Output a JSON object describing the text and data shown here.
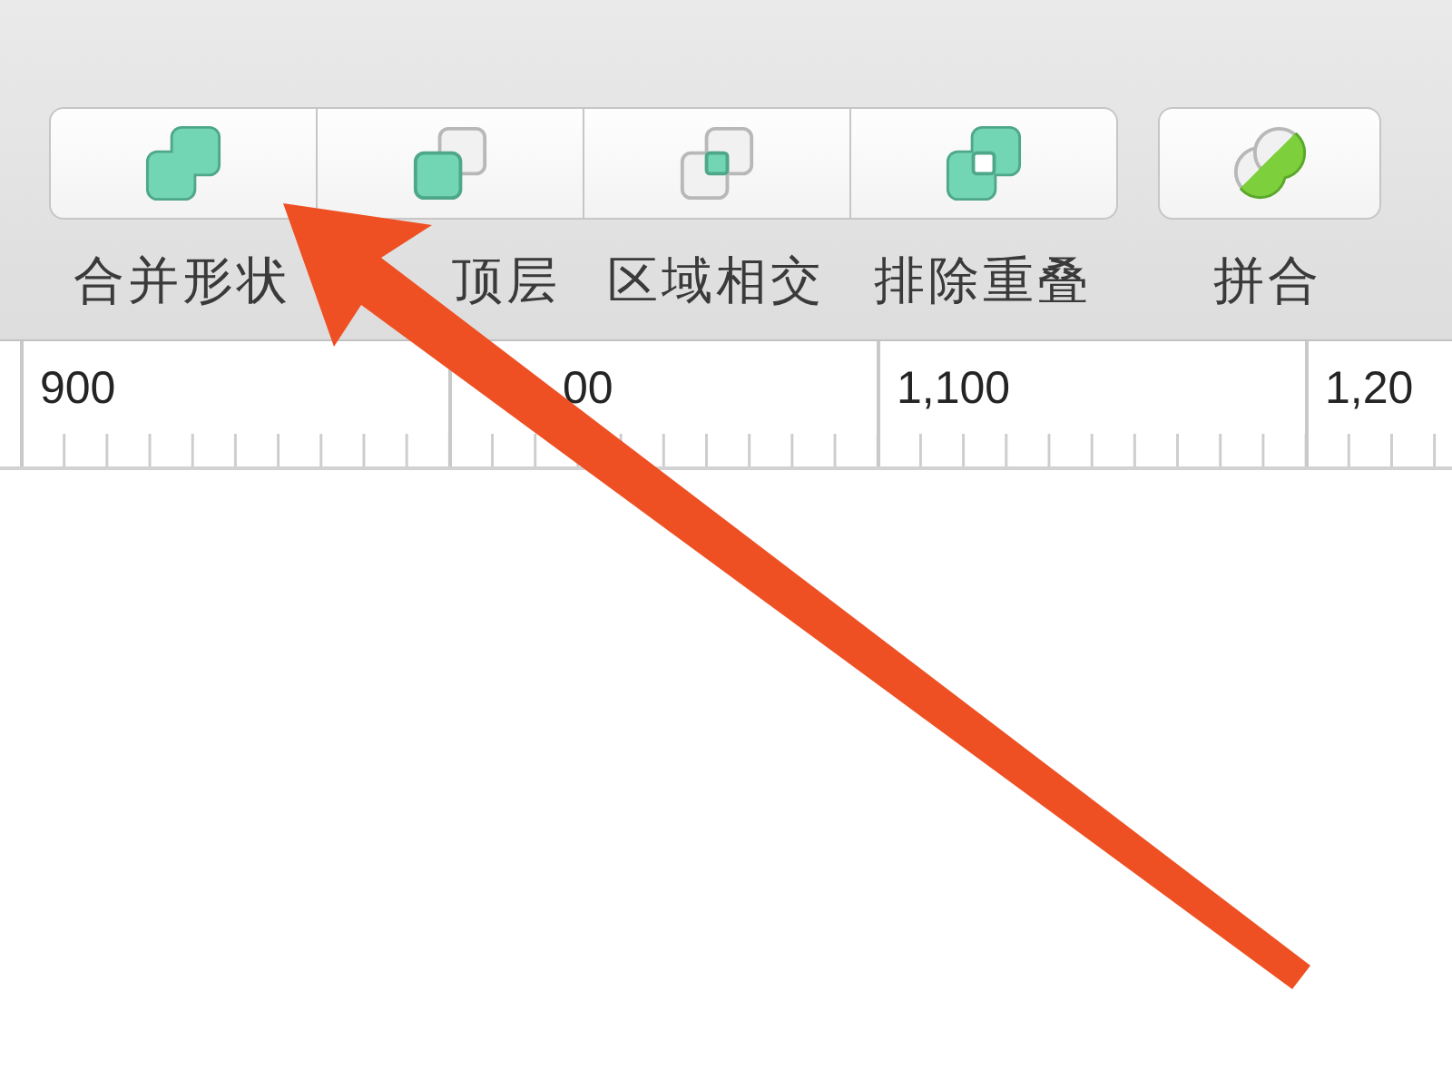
{
  "toolbar": {
    "segmented": [
      {
        "kind": "union",
        "label": "合并形状"
      },
      {
        "kind": "subtract",
        "label": "顶层"
      },
      {
        "kind": "intersect",
        "label": "区域相交"
      },
      {
        "kind": "difference",
        "label": "排除重叠"
      }
    ],
    "single": {
      "kind": "flatten",
      "label": "拼合"
    }
  },
  "ruler": {
    "labels": [
      "900",
      "00",
      "1,100",
      "1,20"
    ]
  }
}
